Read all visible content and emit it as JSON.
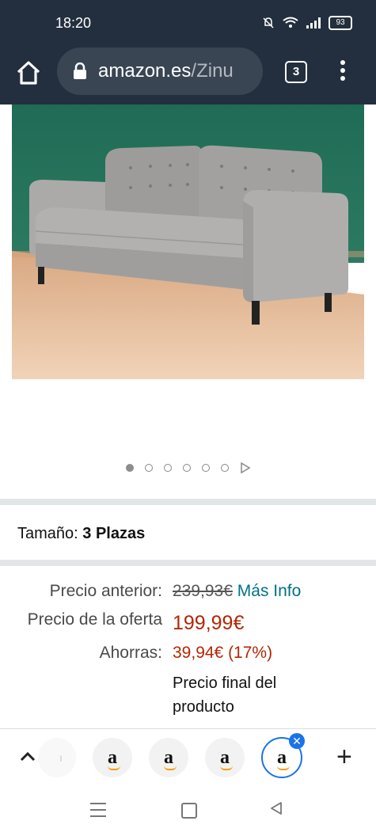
{
  "status_bar": {
    "time": "18:20",
    "battery": "93"
  },
  "browser": {
    "url_domain": "amazon.es",
    "url_path": "/Zinu",
    "tab_count": "3"
  },
  "carousel": {
    "total_images": 6,
    "active_index": 0
  },
  "size": {
    "label": "Tamaño:",
    "value": "3 Plazas"
  },
  "prices": {
    "previous_label": "Precio anterior:",
    "previous_value": "239,93€",
    "more_info": "Más Info",
    "deal_label": "Precio de la oferta",
    "deal_value": "199,99€",
    "savings_label": "Ahorras:",
    "savings_value": "39,94€ (17%)",
    "final_note_line1": "Precio final del",
    "final_note_line2": "producto"
  },
  "tab_strip": {
    "tabs": [
      {
        "letter": "a"
      },
      {
        "letter": "a"
      },
      {
        "letter": "a"
      },
      {
        "letter": "a"
      }
    ],
    "active_tab": 3
  },
  "colors": {
    "header_bg": "#232f3e",
    "price_red": "#b12704",
    "link_teal": "#007185",
    "tab_accent": "#1a73e8"
  }
}
